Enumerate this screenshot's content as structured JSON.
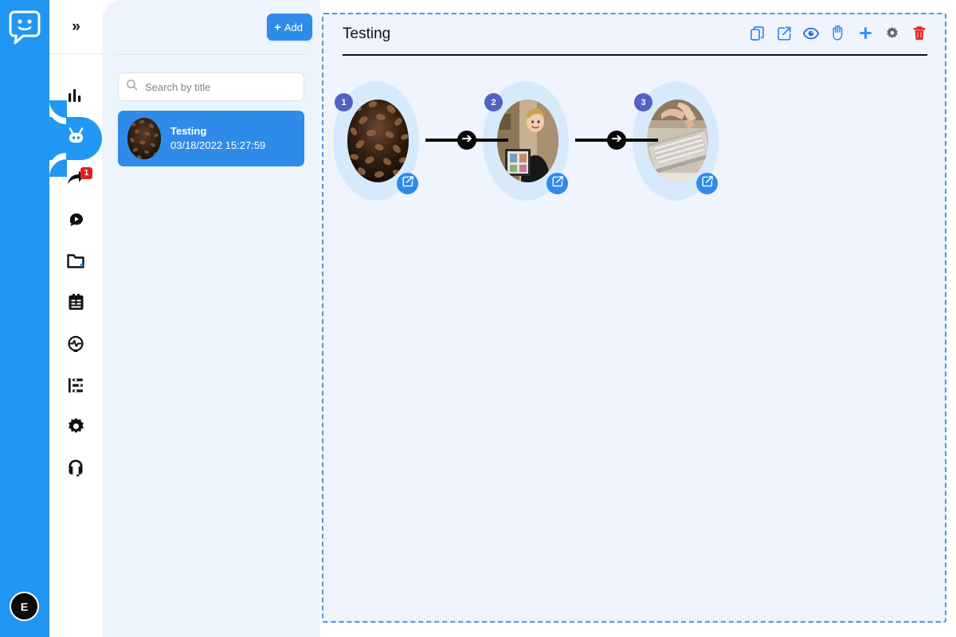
{
  "brand": {
    "logo_icon": "chat-smiley-logo",
    "accent_color": "#2196f3",
    "avatar_initial": "E"
  },
  "icon_nav": {
    "collapse_label": "»",
    "items": [
      {
        "icon": "bar-chart-icon",
        "name": "analytics",
        "active": false,
        "badge": ""
      },
      {
        "icon": "robot-icon",
        "name": "bots",
        "active": true,
        "badge": ""
      },
      {
        "icon": "share-arrow-icon",
        "name": "share",
        "active": false,
        "badge": "1"
      },
      {
        "icon": "broadcast-icon",
        "name": "broadcast",
        "active": false,
        "badge": ""
      },
      {
        "icon": "folder-icon",
        "name": "files",
        "active": false,
        "badge": ""
      },
      {
        "icon": "clipboard-list-icon",
        "name": "tasks",
        "active": false,
        "badge": ""
      },
      {
        "icon": "pulse-icon",
        "name": "activity",
        "active": false,
        "badge": ""
      },
      {
        "icon": "list-settings-icon",
        "name": "lists",
        "active": false,
        "badge": ""
      },
      {
        "icon": "gear-icon",
        "name": "settings",
        "active": false,
        "badge": ""
      },
      {
        "icon": "headset-icon",
        "name": "support",
        "active": false,
        "badge": ""
      }
    ]
  },
  "list_panel": {
    "add_label": "Add",
    "add_icon": "plus-icon",
    "search": {
      "icon": "search-icon",
      "placeholder": "Search by title",
      "value": ""
    },
    "items": [
      {
        "title": "Testing",
        "date": "03/18/2022 15:27:59",
        "selected": true,
        "thumbnail": "coffee-beans-photo"
      }
    ]
  },
  "canvas": {
    "title": "Testing",
    "background_color": "#eff4fe",
    "border_color": "#4d94ee",
    "tools": [
      {
        "name": "copy-button",
        "icon": "copy-icon",
        "color": "#2f8bea"
      },
      {
        "name": "open-external-button",
        "icon": "external-link-icon",
        "color": "#2f8bea"
      },
      {
        "name": "preview-button",
        "icon": "eye-icon",
        "color": "#1f6fd4"
      },
      {
        "name": "pan-button",
        "icon": "hand-icon",
        "color": "#2f8bea"
      },
      {
        "name": "add-node-button",
        "icon": "plus-icon",
        "color": "#3b95ee"
      },
      {
        "name": "settings-button",
        "icon": "gear-icon",
        "color": "#5f6a72"
      },
      {
        "name": "delete-button",
        "icon": "trash-icon",
        "color": "#e8281e"
      }
    ],
    "flow": {
      "nodes": [
        {
          "seq": "1",
          "photo": "coffee-beans-photo",
          "edit_icon": "edit-square-icon"
        },
        {
          "seq": "2",
          "photo": "woman-portrait-photo",
          "edit_icon": "edit-square-icon"
        },
        {
          "seq": "3",
          "photo": "keyboard-hands-photo",
          "edit_icon": "edit-square-icon"
        }
      ],
      "connectors": [
        {
          "icon": "arrow-right-icon"
        },
        {
          "icon": "arrow-right-icon"
        }
      ],
      "badge_color": "#5162c0",
      "halo_color": "#d7eafc",
      "connector_color": "#0a0a0a"
    }
  }
}
